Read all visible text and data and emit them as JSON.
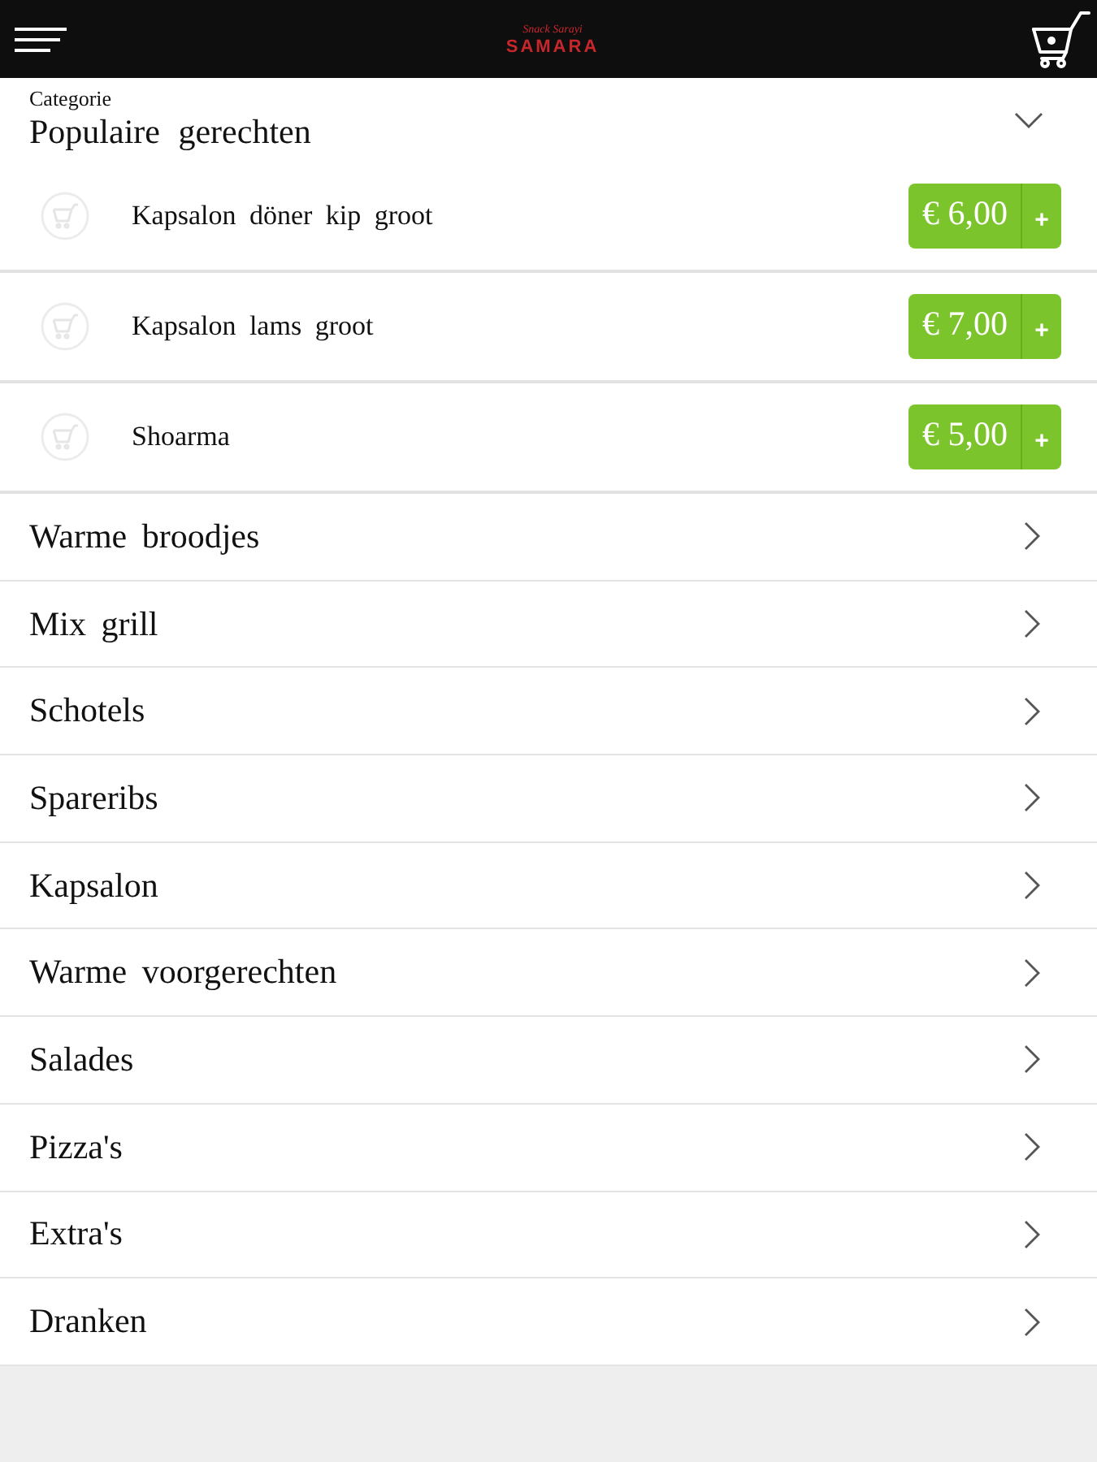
{
  "header": {
    "logo": {
      "tagline": "Snack Sarayi",
      "name": "SAMARA"
    }
  },
  "category_picker": {
    "label": "Categorie",
    "value": "Populaire gerechten",
    "expanded": true
  },
  "products": [
    {
      "name": "Kapsalon döner kip groot",
      "price": "€ 6,00",
      "add": "+"
    },
    {
      "name": "Kapsalon lams groot",
      "price": "€ 7,00",
      "add": "+"
    },
    {
      "name": "Shoarma",
      "price": "€ 5,00",
      "add": "+"
    }
  ],
  "categories": [
    {
      "label": "Warme broodjes"
    },
    {
      "label": "Mix grill"
    },
    {
      "label": "Schotels"
    },
    {
      "label": "Spareribs"
    },
    {
      "label": "Kapsalon"
    },
    {
      "label": "Warme voorgerechten"
    },
    {
      "label": "Salades"
    },
    {
      "label": "Pizza's"
    },
    {
      "label": "Extra's"
    },
    {
      "label": "Dranken"
    }
  ]
}
